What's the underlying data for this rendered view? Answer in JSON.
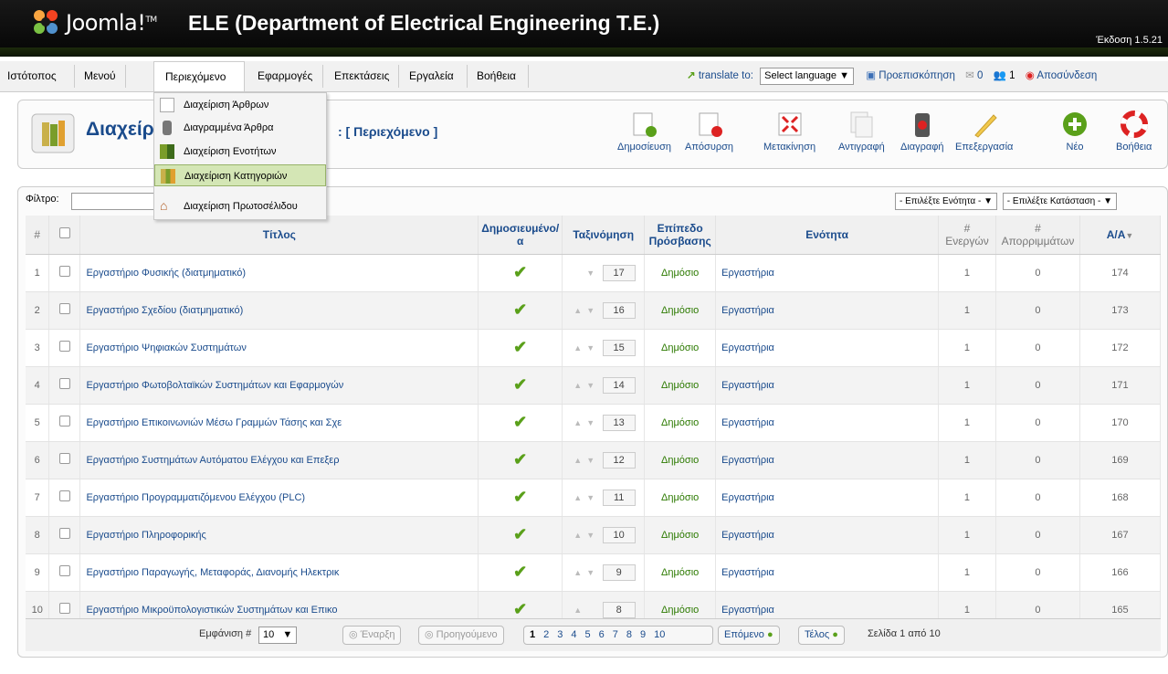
{
  "header": {
    "brand": "Joomla!",
    "brand_tm": "TM",
    "site_name": "ELE (Department of Electrical Engineering T.E.)",
    "version": "Έκδοση 1.5.21"
  },
  "menu": {
    "items": [
      {
        "label": "Ιστότοπος"
      },
      {
        "label": "Μενού"
      },
      {
        "label": "Περιεχόμενο"
      },
      {
        "label": "Εφαρμογές"
      },
      {
        "label": "Επεκτάσεις"
      },
      {
        "label": "Εργαλεία"
      },
      {
        "label": "Βοήθεια"
      }
    ],
    "translate_label": "translate to:",
    "language_select": "Select language",
    "preview": "Προεπισκόπηση",
    "messages_count": "0",
    "users_count": "1",
    "logout": "Αποσύνδεση"
  },
  "dropdown": {
    "items": [
      {
        "label": "Διαχείριση Άρθρων"
      },
      {
        "label": "Διαγραμμένα Άρθρα"
      },
      {
        "label": "Διαχείριση Ενοτήτων"
      },
      {
        "label": "Διαχείριση Κατηγοριών"
      },
      {
        "label": "Διαχείριση Πρωτοσέλιδου"
      }
    ]
  },
  "page": {
    "title": "Διαχείρ",
    "subtitle": ": [ Περιεχόμενο ]"
  },
  "toolbar": {
    "publish": "Δημοσίευση",
    "unpublish": "Απόσυρση",
    "move": "Μετακίνηση",
    "copy": "Αντιγραφή",
    "delete": "Διαγραφή",
    "edit": "Επεξεργασία",
    "new": "Νέο",
    "help": "Βοήθεια"
  },
  "filter": {
    "label": "Φίλτρο:",
    "value": "",
    "section_select": "- Επιλέξτε Ενότητα -",
    "state_select": "- Επιλέξτε Κατάσταση -"
  },
  "table": {
    "headers": {
      "num": "#",
      "title": "Τίτλος",
      "published_1": "Δημοσιευμένο/",
      "published_2": "α",
      "order": "Ταξινόμηση",
      "access_1": "Επίπεδο",
      "access_2": "Πρόσβασης",
      "section": "Ενότητα",
      "active_1": "#",
      "active_2": "Ενεργών",
      "trash_1": "#",
      "trash_2": "Απορριμμάτων",
      "id": "Α/Α"
    },
    "rows": [
      {
        "num": "1",
        "title": "Εργαστήριο Φυσικής (διατμηματικό)",
        "order": "17",
        "access": "Δημόσιο",
        "section": "Εργαστήρια",
        "active": "1",
        "trash": "0",
        "id": "174"
      },
      {
        "num": "2",
        "title": "Εργαστήριο Σχεδίου (διατμηματικό)",
        "order": "16",
        "access": "Δημόσιο",
        "section": "Εργαστήρια",
        "active": "1",
        "trash": "0",
        "id": "173"
      },
      {
        "num": "3",
        "title": "Εργαστήριο Ψηφιακών Συστημάτων",
        "order": "15",
        "access": "Δημόσιο",
        "section": "Εργαστήρια",
        "active": "1",
        "trash": "0",
        "id": "172"
      },
      {
        "num": "4",
        "title": "Εργαστήριο Φωτοβολταϊκών Συστημάτων και Εφαρμογών",
        "order": "14",
        "access": "Δημόσιο",
        "section": "Εργαστήρια",
        "active": "1",
        "trash": "0",
        "id": "171"
      },
      {
        "num": "5",
        "title": "Εργαστήριο Επικοινωνιών Μέσω Γραμμών Τάσης και Σχε",
        "order": "13",
        "access": "Δημόσιο",
        "section": "Εργαστήρια",
        "active": "1",
        "trash": "0",
        "id": "170"
      },
      {
        "num": "6",
        "title": "Εργαστήριο Συστημάτων Αυτόματου Ελέγχου και Επεξερ",
        "order": "12",
        "access": "Δημόσιο",
        "section": "Εργαστήρια",
        "active": "1",
        "trash": "0",
        "id": "169"
      },
      {
        "num": "7",
        "title": "Εργαστήριο Προγραμματιζόμενου Ελέγχου (PLC)",
        "order": "11",
        "access": "Δημόσιο",
        "section": "Εργαστήρια",
        "active": "1",
        "trash": "0",
        "id": "168"
      },
      {
        "num": "8",
        "title": "Εργαστήριο Πληροφορικής",
        "order": "10",
        "access": "Δημόσιο",
        "section": "Εργαστήρια",
        "active": "1",
        "trash": "0",
        "id": "167"
      },
      {
        "num": "9",
        "title": "Εργαστήριο Παραγωγής, Μεταφοράς, Διανομής Ηλεκτρικ",
        "order": "9",
        "access": "Δημόσιο",
        "section": "Εργαστήρια",
        "active": "1",
        "trash": "0",
        "id": "166"
      },
      {
        "num": "10",
        "title": "Εργαστήριο Μικροϋπολογιστικών Συστημάτων και Επικο",
        "order": "8",
        "access": "Δημόσιο",
        "section": "Εργαστήρια",
        "active": "1",
        "trash": "0",
        "id": "165"
      }
    ]
  },
  "pagination": {
    "display_label": "Εμφάνιση #",
    "display_value": "10",
    "start": "Έναρξη",
    "prev": "Προηγούμενο",
    "pages": [
      "1",
      "2",
      "3",
      "4",
      "5",
      "6",
      "7",
      "8",
      "9",
      "10"
    ],
    "next": "Επόμενο",
    "end": "Τέλος",
    "page_info": "Σελίδα 1 από 10"
  }
}
